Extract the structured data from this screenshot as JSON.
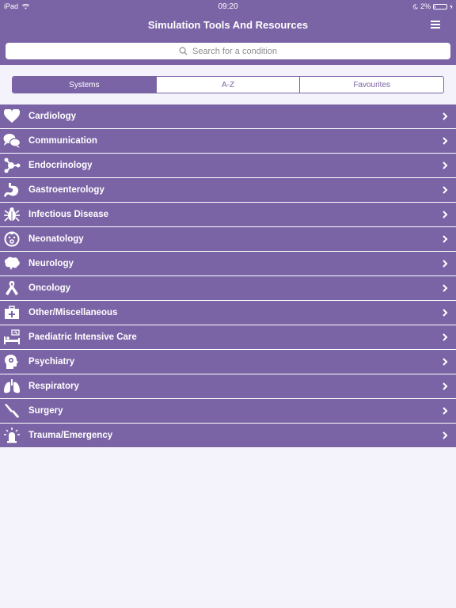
{
  "status": {
    "device": "iPad",
    "time": "09:20",
    "battery": "2%"
  },
  "nav": {
    "title": "Simulation Tools And Resources"
  },
  "search": {
    "placeholder": "Search for a condition"
  },
  "segments": [
    "Systems",
    "A-Z",
    "Favourites"
  ],
  "systems": [
    {
      "label": "Cardiology",
      "icon": "heart-icon"
    },
    {
      "label": "Communication",
      "icon": "speech-bubbles-icon"
    },
    {
      "label": "Endocrinology",
      "icon": "molecule-icon"
    },
    {
      "label": "Gastroenterology",
      "icon": "stomach-icon"
    },
    {
      "label": "Infectious Disease",
      "icon": "bug-icon"
    },
    {
      "label": "Neonatology",
      "icon": "baby-icon"
    },
    {
      "label": "Neurology",
      "icon": "brain-icon"
    },
    {
      "label": "Oncology",
      "icon": "ribbon-icon"
    },
    {
      "label": "Other/Miscellaneous",
      "icon": "first-aid-kit-icon"
    },
    {
      "label": "Paediatric Intensive Care",
      "icon": "hospital-bed-icon"
    },
    {
      "label": "Psychiatry",
      "icon": "head-puzzle-icon"
    },
    {
      "label": "Respiratory",
      "icon": "lungs-icon"
    },
    {
      "label": "Surgery",
      "icon": "scalpel-icon"
    },
    {
      "label": "Trauma/Emergency",
      "icon": "siren-icon"
    }
  ],
  "colors": {
    "primary": "#7b64a6",
    "background": "#f4f3fb"
  }
}
